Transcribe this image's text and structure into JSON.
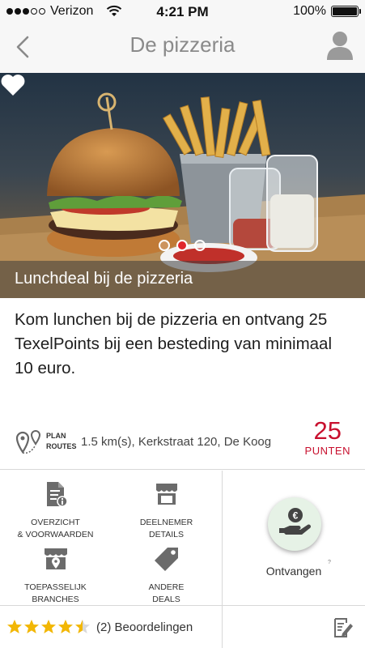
{
  "status_bar": {
    "carrier": "Verizon",
    "time": "4:21 PM",
    "battery": "100%",
    "signal_bars_filled": 3,
    "signal_bars_total": 5
  },
  "nav": {
    "title": "De pizzeria",
    "back_icon": "chevron-left-icon",
    "profile_icon": "user-icon"
  },
  "hero": {
    "caption": "Lunchdeal bij de pizzeria",
    "favorite_icon": "heart-icon",
    "slides_total": 3,
    "slide_active": 2
  },
  "description": "Kom lunchen bij de pizzeria en ontvang 25 TexelPoints bij een besteding van minimaal 10 euro.",
  "location": {
    "plan_line1": "PLAN",
    "plan_line2": "ROUTES",
    "address": "1.5 km(s), Kerkstraat 120, De Koog",
    "points_value": "25",
    "points_label": "PUNTEN"
  },
  "actions": [
    {
      "line1": "Overzicht",
      "line2": "& voorwaarden",
      "icon": "document-info-icon"
    },
    {
      "line1": "Deelnemer",
      "line2": "details",
      "icon": "storefront-icon"
    },
    {
      "line1": "Toepasselijk",
      "line2": "branches",
      "icon": "store-location-icon"
    },
    {
      "line1": "Andere",
      "line2": "deals",
      "icon": "tag-icon"
    }
  ],
  "receive": {
    "label": "Ontvangen",
    "icon": "euro-hand-icon",
    "superscript": "?"
  },
  "rating": {
    "value": 4.5,
    "max": 5,
    "label": "(2) Beoordelingen",
    "write_icon": "edit-review-icon"
  },
  "colors": {
    "accent_red": "#c8102e",
    "star_gold": "#f2b705",
    "icon_gray": "#6b6b6b",
    "bar_gray": "#f7f7f7"
  }
}
